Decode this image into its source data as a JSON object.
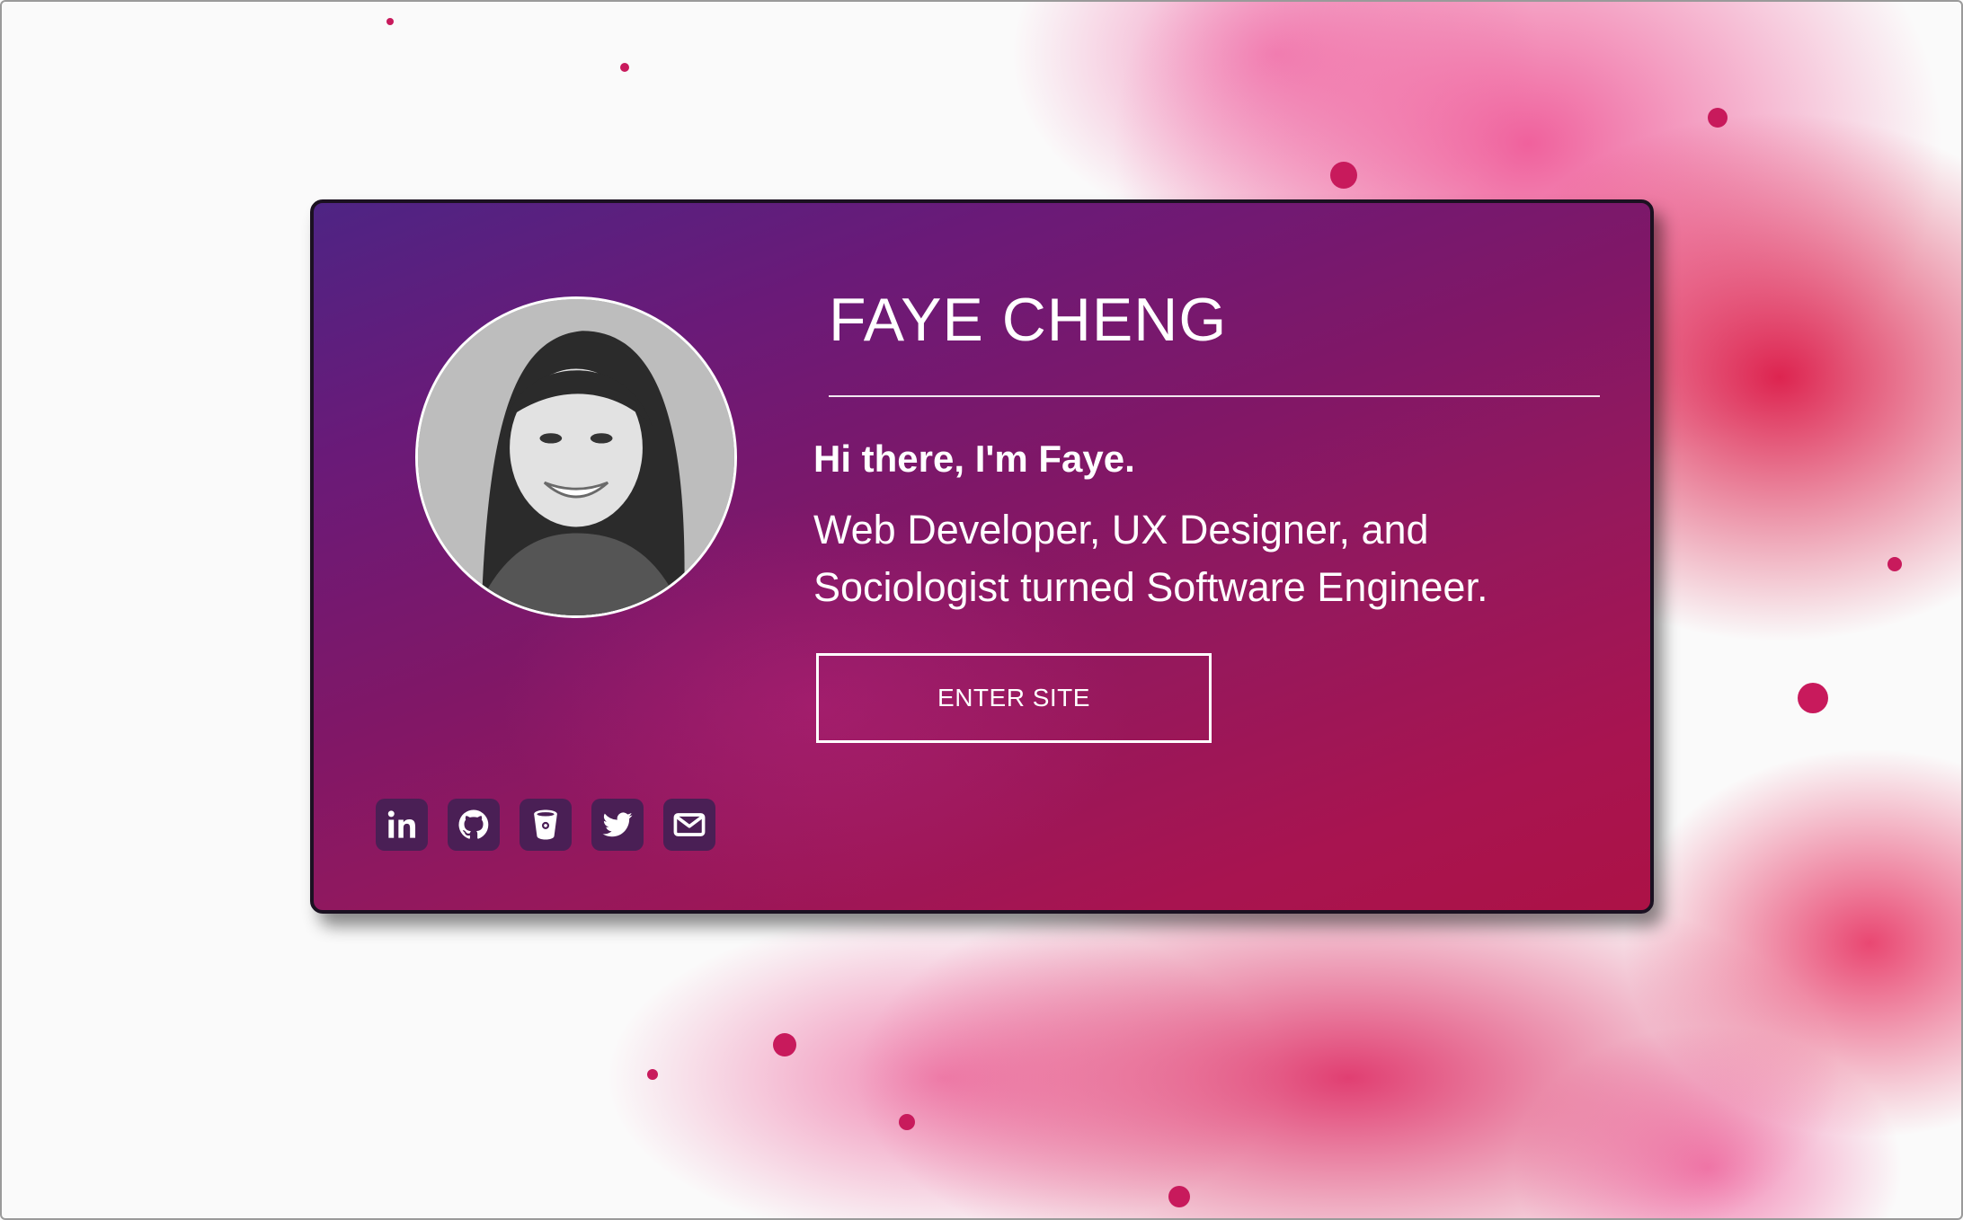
{
  "profile": {
    "name": "FAYE CHENG",
    "greeting": "Hi there, I'm Faye.",
    "bio": "Web Developer, UX Designer, and Sociologist turned Software Engineer."
  },
  "actions": {
    "enter_label": "ENTER SITE"
  },
  "social_links": [
    {
      "icon": "linkedin-icon"
    },
    {
      "icon": "github-icon"
    },
    {
      "icon": "bitbucket-icon"
    },
    {
      "icon": "twitter-icon"
    },
    {
      "icon": "email-icon"
    }
  ],
  "colors": {
    "card_gradient_start": "#4e2484",
    "card_gradient_end": "#ac1246",
    "social_icon_bg": "#4a1f55",
    "splash_accent": "#e0205a",
    "text": "#ffffff"
  }
}
